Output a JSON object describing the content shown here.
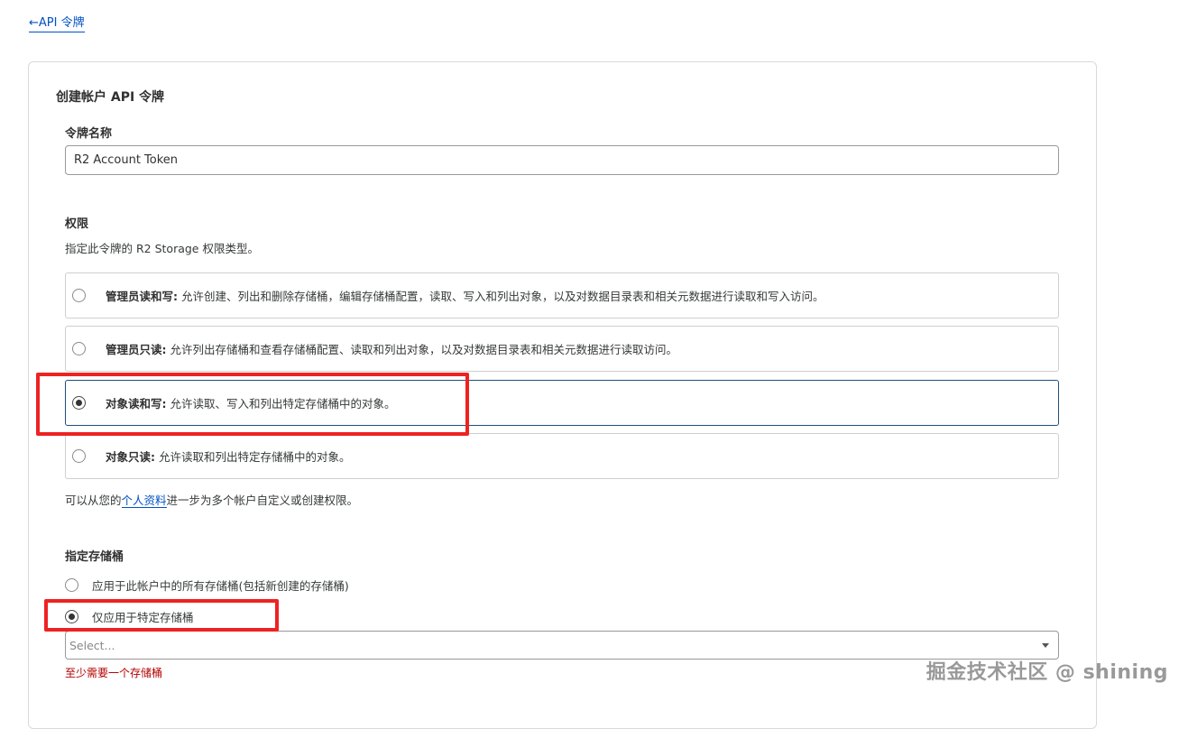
{
  "nav": {
    "back_label": "←API 令牌"
  },
  "card": {
    "title": "创建帐户 API 令牌"
  },
  "token_name": {
    "label": "令牌名称",
    "value": "R2 Account Token"
  },
  "permissions": {
    "label": "权限",
    "description": "指定此令牌的 R2 Storage 权限类型。",
    "options": [
      {
        "title": "管理员读和写:",
        "text": " 允许创建、列出和删除存储桶，编辑存储桶配置，读取、写入和列出对象，以及对数据目录表和相关元数据进行读取和写入访问。",
        "selected": false
      },
      {
        "title": "管理员只读:",
        "text": " 允许列出存储桶和查看存储桶配置、读取和列出对象，以及对数据目录表和相关元数据进行读取访问。",
        "selected": false
      },
      {
        "title": "对象读和写:",
        "text": " 允许读取、写入和列出特定存储桶中的对象。",
        "selected": true
      },
      {
        "title": "对象只读:",
        "text": " 允许读取和列出特定存储桶中的对象。",
        "selected": false
      }
    ],
    "footer_prefix": "可以从您的",
    "footer_link": "个人资料",
    "footer_suffix": "进一步为多个帐户自定义或创建权限。"
  },
  "buckets": {
    "label": "指定存储桶",
    "options": [
      {
        "label": "应用于此帐户中的所有存储桶(包括新创建的存储桶)",
        "selected": false
      },
      {
        "label": "仅应用于特定存储桶",
        "selected": true
      }
    ],
    "select_placeholder": "Select...",
    "error": "至少需要一个存储桶"
  },
  "watermark": "掘金技术社区 @ shining",
  "colors": {
    "link": "#0051c3",
    "highlight": "#ee2222",
    "error": "#b30000"
  }
}
